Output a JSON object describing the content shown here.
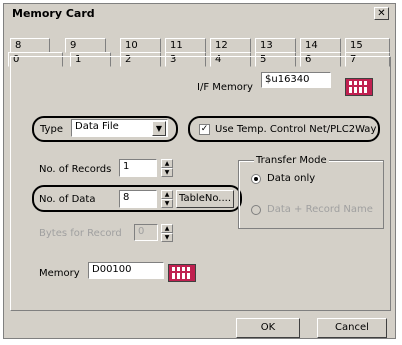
{
  "window": {
    "title": "Memory Card",
    "close_glyph": "✕"
  },
  "tabs_top": [
    "8",
    "9",
    "10",
    "11",
    "12",
    "13",
    "14",
    "15"
  ],
  "tabs_bottom": [
    "0",
    "1",
    "2",
    "3",
    "4",
    "5",
    "6",
    "7"
  ],
  "if_memory": {
    "label": "I/F Memory",
    "value": "$u16340"
  },
  "type": {
    "label": "Type",
    "value": "Data File"
  },
  "use_temp": {
    "label": "Use Temp. Control Net/PLC2Way",
    "checked": true
  },
  "records": {
    "label": "No. of Records",
    "value": "1"
  },
  "data_count": {
    "label": "No. of Data",
    "value": "8",
    "button": "TableNo...."
  },
  "bytes": {
    "label": "Bytes for Record",
    "value": "0"
  },
  "transfer_mode": {
    "label": "Transfer Mode",
    "opt1": "Data only",
    "opt2": "Data + Record Name"
  },
  "memory": {
    "label": "Memory",
    "value": "D00100"
  },
  "buttons": {
    "ok": "OK",
    "cancel": "Cancel"
  },
  "icons": {
    "calculator": "calculator-icon",
    "close": "close-icon"
  }
}
